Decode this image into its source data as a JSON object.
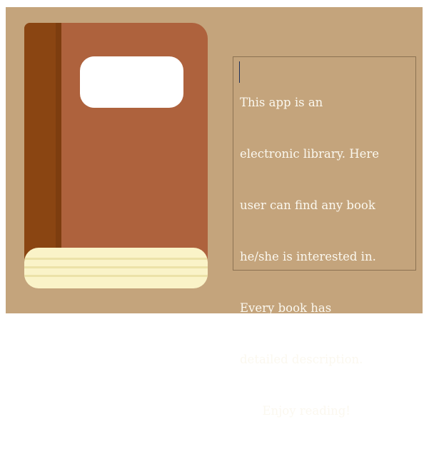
{
  "description": {
    "lines": [
      "This app is an",
      "electronic library. Here",
      "user can find any book",
      "he/she is interested in.",
      "Every book has",
      "detailed description.",
      "      Enjoy reading!"
    ]
  },
  "colors": {
    "background": "#c4a47c",
    "cover": "#ae623d",
    "spine": "#8a4512",
    "pages": "#faf3c8",
    "text": "#fbf8ef"
  },
  "icons": {
    "book": "book-icon"
  }
}
